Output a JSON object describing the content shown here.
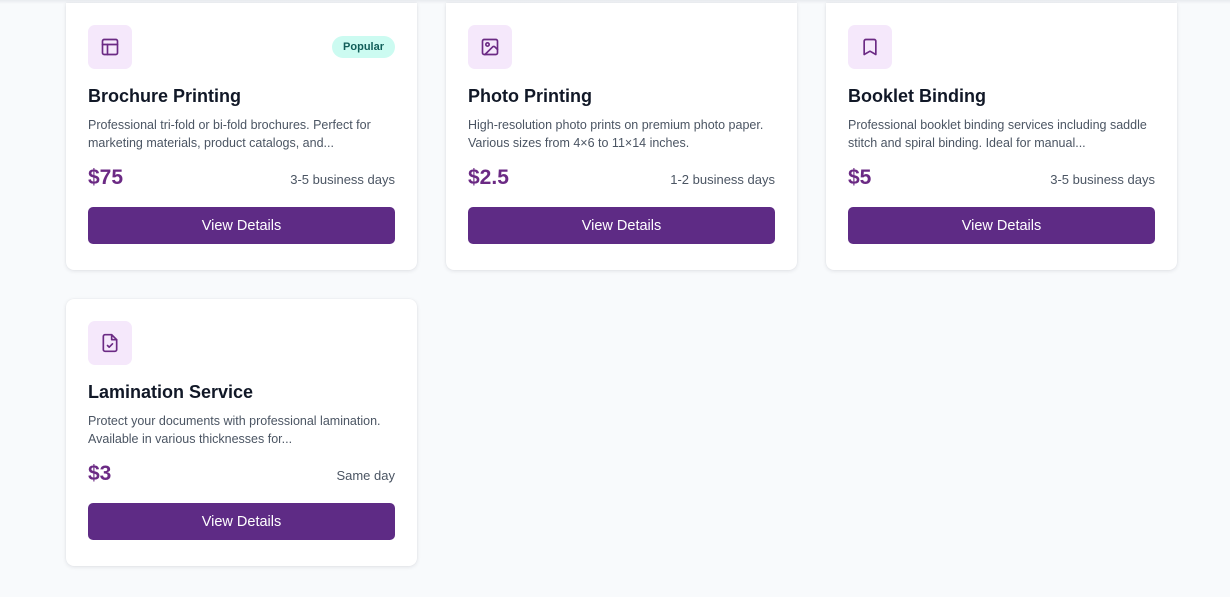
{
  "accent_color": "#5e2b85",
  "price_color": "#6b2a84",
  "icon_bg_color": "#f5e8fb",
  "badge_color": "#ccfbf1",
  "services": [
    {
      "icon": "layout-icon",
      "badge": "Popular",
      "title": "Brochure Printing",
      "description": "Professional tri-fold or bi-fold brochures. Perfect for marketing materials, product catalogs, and...",
      "price": "$75",
      "turnaround": "3-5 business days",
      "button_label": "View Details"
    },
    {
      "icon": "image-icon",
      "badge": "",
      "title": "Photo Printing",
      "description": "High-resolution photo prints on premium photo paper. Various sizes from 4×6 to 11×14 inches.",
      "price": "$2.5",
      "turnaround": "1-2 business days",
      "button_label": "View Details"
    },
    {
      "icon": "bookmark-icon",
      "badge": "",
      "title": "Booklet Binding",
      "description": "Professional booklet binding services including saddle stitch and spiral binding. Ideal for manual...",
      "price": "$5",
      "turnaround": "3-5 business days",
      "button_label": "View Details"
    },
    {
      "icon": "file-check-icon",
      "badge": "",
      "title": "Lamination Service",
      "description": "Protect your documents with professional lamination. Available in various thicknesses for...",
      "price": "$3",
      "turnaround": "Same day",
      "button_label": "View Details"
    }
  ]
}
